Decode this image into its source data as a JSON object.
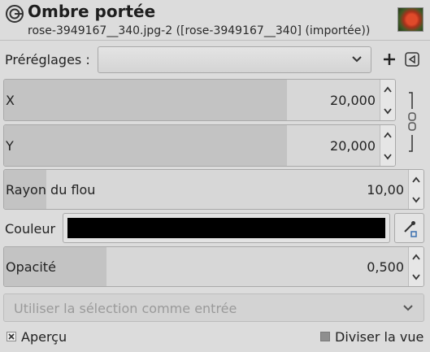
{
  "header": {
    "title": "Ombre portée",
    "subtitle": "rose-3949167__340.jpg-2 ([rose-3949167__340] (importée))",
    "app_icon": "gimp-icon",
    "thumbnail": "rose-image-thumbnail"
  },
  "presets": {
    "label": "Préréglages :",
    "selected": "",
    "add_icon": "plus-icon",
    "menu_icon": "triangle-left-icon"
  },
  "params": {
    "x": {
      "label": "X",
      "value": "20,000",
      "fraction": 0.73
    },
    "y": {
      "label": "Y",
      "value": "20,000",
      "fraction": 0.73
    },
    "chain_icon": "chain-link-icon",
    "blur": {
      "label": "Rayon du flou",
      "value": "10,00",
      "fraction": 0.1
    },
    "color": {
      "label": "Couleur",
      "swatch": "#000000",
      "picker_icon": "color-picker-icon"
    },
    "opacity": {
      "label": "Opacité",
      "value": "0,500",
      "fraction": 0.24
    }
  },
  "selection_input": {
    "label": "Utiliser la sélection comme entrée",
    "enabled": false
  },
  "footer": {
    "preview": {
      "label": "Aperçu",
      "checked": true
    },
    "split": {
      "label": "Diviser la vue",
      "checked": false
    }
  }
}
